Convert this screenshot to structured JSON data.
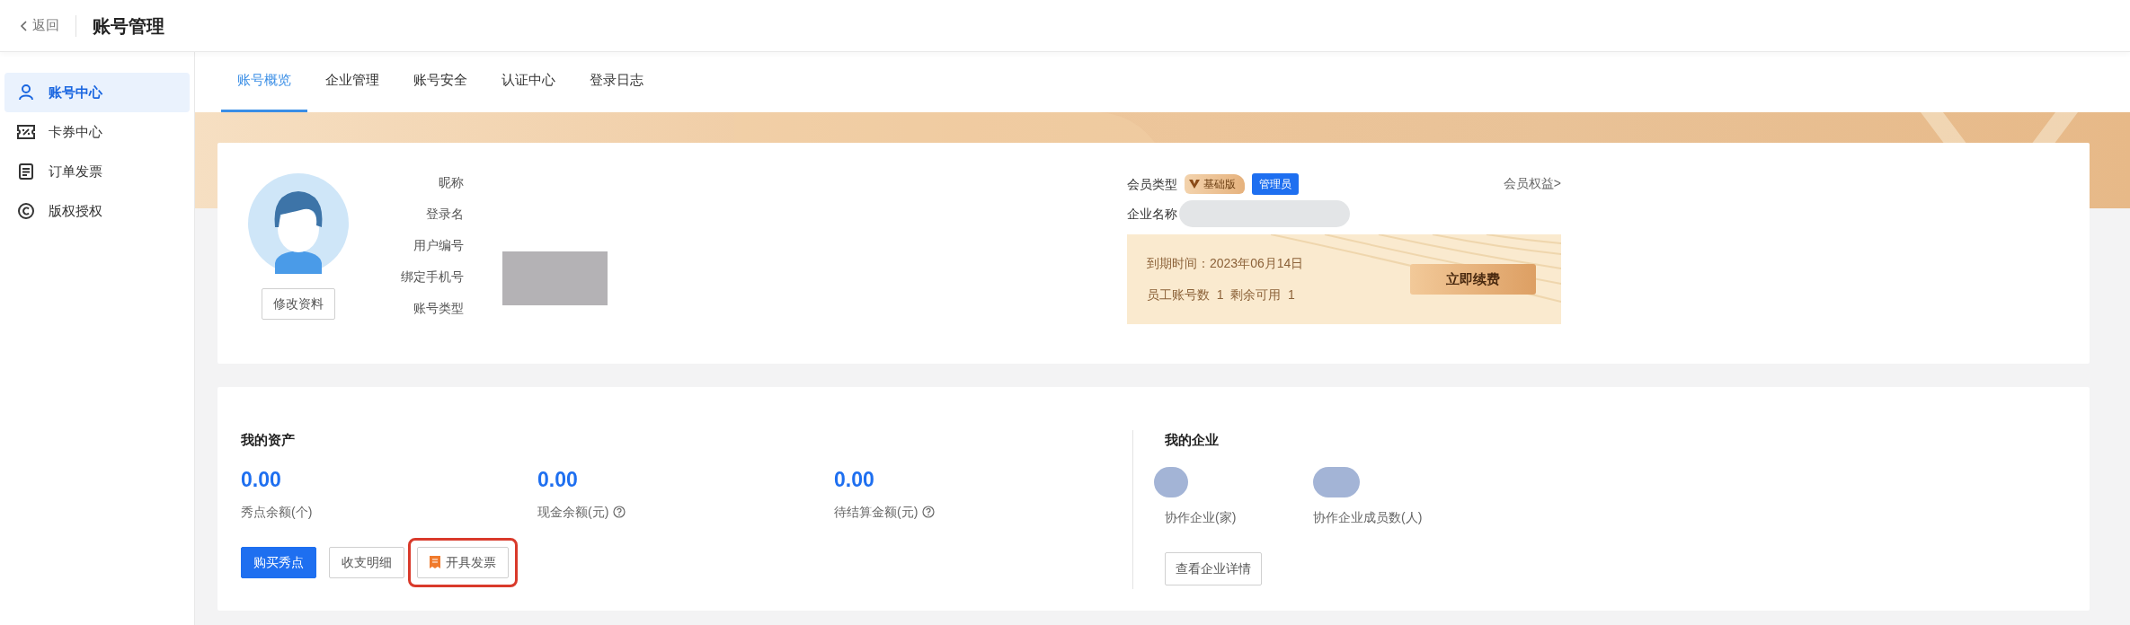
{
  "header": {
    "back_label": "返回",
    "title": "账号管理"
  },
  "sidebar": {
    "items": [
      {
        "label": "账号中心",
        "selected": true
      },
      {
        "label": "卡券中心",
        "selected": false
      },
      {
        "label": "订单发票",
        "selected": false
      },
      {
        "label": "版权授权",
        "selected": false
      }
    ]
  },
  "tabs": [
    {
      "label": "账号概览",
      "selected": true
    },
    {
      "label": "企业管理",
      "selected": false
    },
    {
      "label": "账号安全",
      "selected": false
    },
    {
      "label": "认证中心",
      "selected": false
    },
    {
      "label": "登录日志",
      "selected": false
    }
  ],
  "profile": {
    "edit_button": "修改资料",
    "fields": [
      "昵称",
      "登录名",
      "用户编号",
      "绑定手机号",
      "账号类型"
    ]
  },
  "membership": {
    "type_label": "会员类型",
    "tier_badge": "基础版",
    "role_badge": "管理员",
    "benefits_link": "会员权益>",
    "company_label": "企业名称",
    "expiry": "到期时间：2023年06月14日",
    "accounts": "员工账号数  1  剩余可用  1",
    "renew_button": "立即续费"
  },
  "assets": {
    "title": "我的资产",
    "items": [
      {
        "value": "0.00",
        "label": "秀点余额(个)",
        "help": false
      },
      {
        "value": "0.00",
        "label": "现金余额(元)",
        "help": true
      },
      {
        "value": "0.00",
        "label": "待结算金额(元)",
        "help": true
      }
    ],
    "buttons": [
      {
        "label": "购买秀点",
        "kind": "primary",
        "highlighted": false
      },
      {
        "label": "收支明细",
        "kind": "default",
        "highlighted": false
      },
      {
        "label": "开具发票",
        "kind": "invoice",
        "highlighted": true
      }
    ]
  },
  "enterprise": {
    "title": "我的企业",
    "stats": [
      {
        "label": "协作企业(家)"
      },
      {
        "label": "协作企业成员数(人)"
      }
    ],
    "button": "查看企业详情"
  }
}
